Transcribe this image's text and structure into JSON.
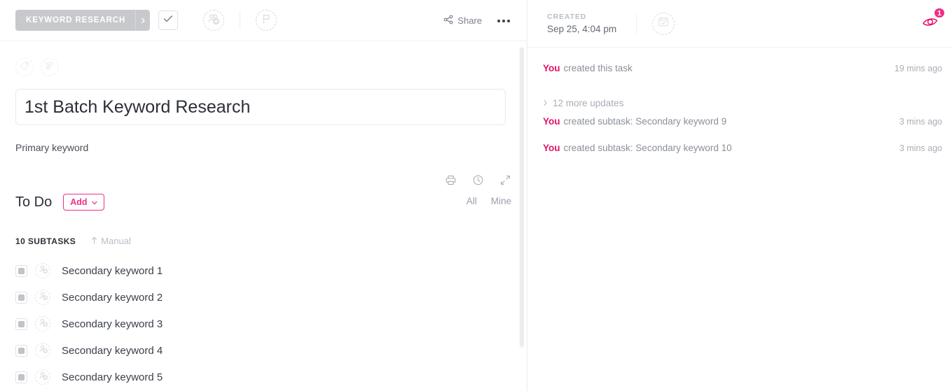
{
  "left": {
    "topbar": {
      "status_label": "KEYWORD RESEARCH",
      "status_caret_icon": "chevron-right-icon",
      "complete_icon": "check-icon",
      "assignee_icon": "add-assignee-icon",
      "flag_icon": "flag-icon",
      "share_label": "Share",
      "share_icon": "share-icon",
      "more_icon": "ellipsis-icon"
    },
    "meta_icons": [
      {
        "name": "tag-icon"
      },
      {
        "name": "custom-fields-icon"
      }
    ],
    "task_title": "1st Batch Keyword Research",
    "description": "Primary keyword",
    "doc_tools": [
      {
        "name": "print-icon"
      },
      {
        "name": "history-icon"
      },
      {
        "name": "expand-icon"
      }
    ],
    "todo": {
      "heading": "To Do",
      "add_label": "Add",
      "add_caret_icon": "chevron-down-icon",
      "filters": [
        "All",
        "Mine"
      ]
    },
    "subtasks": {
      "count_label": "10 SUBTASKS",
      "sort_icon": "sort-asc-icon",
      "sort_label": "Manual",
      "items": [
        {
          "name": "Secondary keyword 1"
        },
        {
          "name": "Secondary keyword 2"
        },
        {
          "name": "Secondary keyword 3"
        },
        {
          "name": "Secondary keyword 4"
        },
        {
          "name": "Secondary keyword 5"
        }
      ]
    }
  },
  "right": {
    "created_label": "CREATED",
    "created_value": "Sep 25, 4:04 pm",
    "calendar_icon": "calendar-icon",
    "watch": {
      "icon": "eye-icon",
      "count": "1"
    },
    "activity": [
      {
        "actor": "You",
        "text": "created this task",
        "time": "19 mins ago"
      },
      {
        "type": "more",
        "expand_icon": "chevron-right-icon",
        "label": "12 more updates"
      },
      {
        "actor": "You",
        "text": "created subtask: Secondary keyword 9",
        "time": "3 mins ago"
      },
      {
        "actor": "You",
        "text": "created subtask: Secondary keyword 10",
        "time": "3 mins ago"
      }
    ]
  },
  "colors": {
    "accent_pink": "#ef2f86",
    "accent_crimson": "#e5106b",
    "status_gray": "#c8c9cc",
    "text_dark": "#2c2f36",
    "text_muted": "#8a9099"
  }
}
